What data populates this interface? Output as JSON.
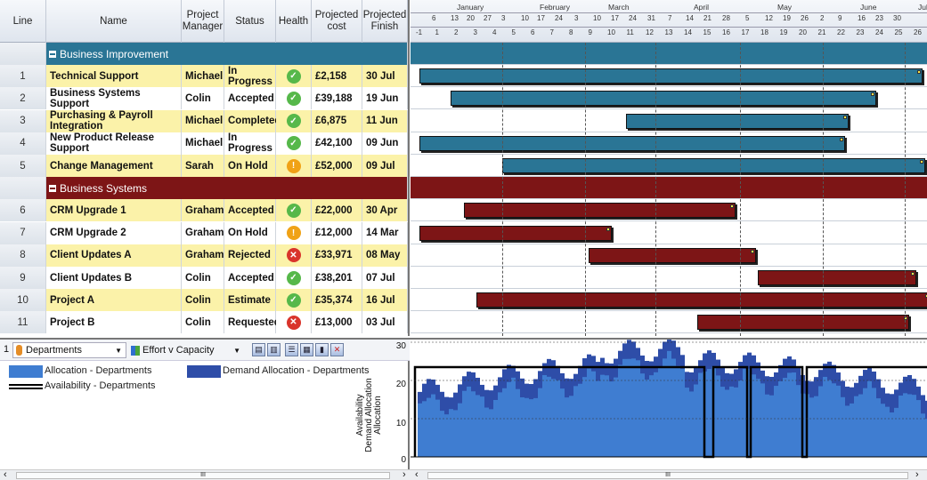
{
  "columns": {
    "line": "Line",
    "name": "Name",
    "pm": "Project Manager",
    "status": "Status",
    "health": "Health",
    "cost": "Projected cost",
    "finish": "Projected Finish"
  },
  "groups": [
    {
      "label": "Business Improvement",
      "color": "#2a7595"
    },
    {
      "label": "Business Systems",
      "color": "#7d1516"
    }
  ],
  "rows": [
    {
      "line": "1",
      "name": "Technical Support",
      "pm": "Michael",
      "status": "In Progress",
      "health": "ok",
      "cost": "£2,158",
      "finish": "30 Jul",
      "group": 0,
      "hl": true
    },
    {
      "line": "2",
      "name": "Business Systems Support",
      "pm": "Colin",
      "status": "Accepted",
      "health": "ok",
      "cost": "£39,188",
      "finish": "19 Jun",
      "group": 0,
      "hl": false
    },
    {
      "line": "3",
      "name": "Purchasing & Payroll Integration",
      "pm": "Michael",
      "status": "Completed",
      "health": "ok",
      "cost": "£6,875",
      "finish": "11 Jun",
      "group": 0,
      "hl": true
    },
    {
      "line": "4",
      "name": "New Product Release Support",
      "pm": "Michael",
      "status": "In Progress",
      "health": "ok",
      "cost": "£42,100",
      "finish": "09 Jun",
      "group": 0,
      "hl": false
    },
    {
      "line": "5",
      "name": "Change Management",
      "pm": "Sarah",
      "status": "On Hold",
      "health": "warn",
      "cost": "£52,000",
      "finish": "09 Jul",
      "group": 0,
      "hl": true
    },
    {
      "line": "6",
      "name": "CRM Upgrade 1",
      "pm": "Graham",
      "status": "Accepted",
      "health": "ok",
      "cost": "£22,000",
      "finish": "30 Apr",
      "group": 1,
      "hl": true
    },
    {
      "line": "7",
      "name": "CRM Upgrade 2",
      "pm": "Graham",
      "status": "On Hold",
      "health": "warn",
      "cost": "£12,000",
      "finish": "14 Mar",
      "group": 1,
      "hl": false
    },
    {
      "line": "8",
      "name": "Client Updates A",
      "pm": "Graham",
      "status": "Rejected",
      "health": "bad",
      "cost": "£33,971",
      "finish": "08 May",
      "group": 1,
      "hl": true
    },
    {
      "line": "9",
      "name": "Client Updates B",
      "pm": "Colin",
      "status": "Accepted",
      "health": "ok",
      "cost": "£38,201",
      "finish": "07 Jul",
      "group": 1,
      "hl": false
    },
    {
      "line": "10",
      "name": "Project A",
      "pm": "Colin",
      "status": "Estimate",
      "health": "ok",
      "cost": "£35,374",
      "finish": "16 Jul",
      "group": 1,
      "hl": true
    },
    {
      "line": "11",
      "name": "Project B",
      "pm": "Colin",
      "status": "Requested",
      "health": "bad",
      "cost": "£13,000",
      "finish": "03 Jul",
      "group": 1,
      "hl": false
    }
  ],
  "months": [
    "January",
    "February",
    "March",
    "April",
    "May",
    "June",
    "July"
  ],
  "day_labels": [
    "6",
    "13",
    "20",
    "27",
    "3",
    "10",
    "17",
    "24",
    "3",
    "10",
    "17",
    "24",
    "31",
    "7",
    "14",
    "21",
    "28",
    "5",
    "12",
    "19",
    "26",
    "2",
    "9",
    "16",
    "23",
    "30"
  ],
  "week_labels": [
    "-1",
    "1",
    "2",
    "3",
    "4",
    "5",
    "6",
    "7",
    "8",
    "9",
    "10",
    "11",
    "12",
    "13",
    "14",
    "15",
    "16",
    "17",
    "18",
    "19",
    "20",
    "21",
    "22",
    "23",
    "24",
    "25",
    "26"
  ],
  "bottom": {
    "index": "1",
    "dimension_select": "Departments",
    "view_select": "Effort v Capacity",
    "legend": [
      {
        "label": "Allocation - Departments",
        "color": "#3f7dd1"
      },
      {
        "label": "Demand Allocation - Departments",
        "color": "#2e4da8"
      },
      {
        "label": "Availability - Departments",
        "color": "#000000"
      }
    ],
    "y_axis_label_1": "Availability",
    "y_axis_label_2": "Demand Allocation",
    "y_axis_label_3": "Allocation",
    "y_ticks": [
      "30",
      "20",
      "10",
      "0"
    ]
  },
  "scroll": {
    "left": "‹",
    "mid": "III",
    "right": "›"
  },
  "colors": {
    "ok": "#56b84a",
    "warn": "#f0a216",
    "bad": "#d9342b",
    "hl": "#fbf2a9",
    "hdr": "#e4e9f0"
  }
}
